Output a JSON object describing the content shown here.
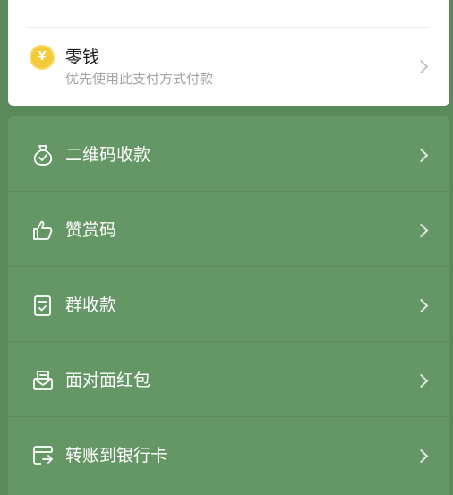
{
  "wallet": {
    "coin_symbol": "¥",
    "title": "零钱",
    "subtitle": "优先使用此支付方式付款"
  },
  "menu": {
    "items": [
      {
        "label": "二维码收款",
        "icon": "money-bag-icon"
      },
      {
        "label": "赞赏码",
        "icon": "thumbs-up-icon"
      },
      {
        "label": "群收款",
        "icon": "group-receipt-icon"
      },
      {
        "label": "面对面红包",
        "icon": "red-packet-icon"
      },
      {
        "label": "转账到银行卡",
        "icon": "bank-card-transfer-icon"
      }
    ]
  },
  "colors": {
    "background": "#5a8a5c",
    "panel": "#659666",
    "card": "#ffffff",
    "coin": "#f4ca38"
  }
}
